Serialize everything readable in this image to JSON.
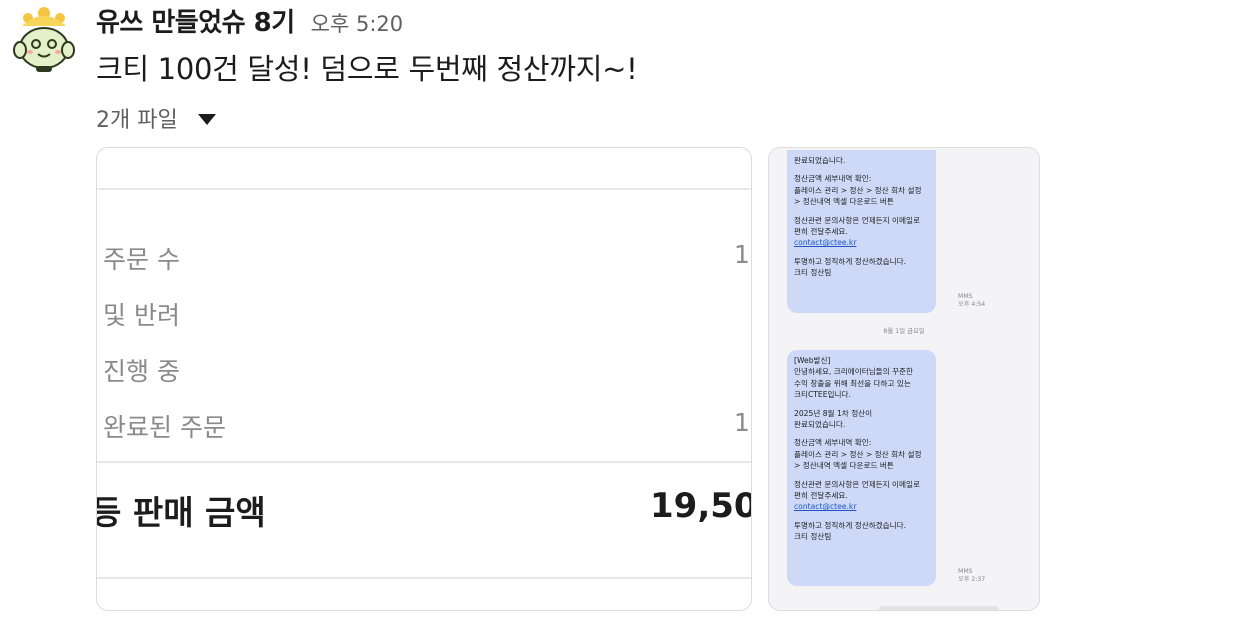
{
  "message": {
    "sender": "유쓰 만들었슈 8기",
    "time": "오후 5:20",
    "text": "크티 100건 달성! 덤으로 두번째 정산까지~!",
    "files_label": "2개 파일"
  },
  "attachment_summary": {
    "rows": [
      {
        "label": "주문 수",
        "value": "1"
      },
      {
        "label": "및 반려",
        "value": ""
      },
      {
        "label": "진행 중",
        "value": ""
      },
      {
        "label": "완료된 주문",
        "value": "1"
      }
    ],
    "total_label": "등 판매 금액",
    "total_value": "19,50"
  },
  "attachment_sms": {
    "bubble1": {
      "lines": [
        "완료되었습니다.",
        "정산금액 세부내역 확인:",
        "플레이스 관리 > 정산 > 정산 회차 설정",
        "> 정산내역 엑셀 다운로드 버튼",
        "정산관련 문의사항은 언제든지 이메일로",
        "편히 전달주세요.",
        "contact@ctee.kr",
        "투명하고 정직하게 정산하겠습니다.",
        "크티 정산팀"
      ],
      "type": "MMS",
      "time": "오후 4:54"
    },
    "date_separator": "8월 1일 금요일",
    "bubble2": {
      "lines": [
        "[Web발신]",
        "안녕하세요, 크리에이터님들의 꾸준한",
        "수익 창출을 위해 최선을 다하고 있는",
        "크티CTEE입니다.",
        "2025년 8월 1차 정산이",
        "완료되었습니다.",
        "정산금액 세부내역 확인:",
        "플레이스 관리 > 정산 > 정산 회차 설정",
        "> 정산내역 엑셀 다운로드 버튼",
        "정산관련 문의사항은 언제든지 이메일로",
        "편히 전달주세요.",
        "contact@ctee.kr",
        "투명하고 정직하게 정산하겠습니다.",
        "크티 정산팀"
      ],
      "type": "MMS",
      "time": "오후 2:37"
    }
  },
  "colors": {
    "bubble": "#cdd9f7",
    "link": "#1a55c9",
    "muted_text": "#616061"
  },
  "icons": {
    "avatar": "mascot-avatar-icon",
    "toggle": "caret-down-icon"
  }
}
